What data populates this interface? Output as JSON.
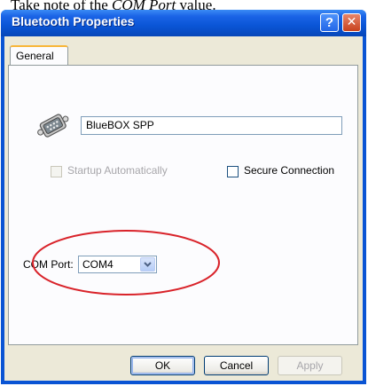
{
  "caption": {
    "prefix": "Take note of the ",
    "emphasis": "COM Port",
    "suffix": " value."
  },
  "window": {
    "title": "Bluetooth Properties",
    "help_label": "?",
    "close_label": "✕"
  },
  "tabs": [
    {
      "label": "General",
      "active": true
    }
  ],
  "device": {
    "icon": "serial-port-icon",
    "name_value": "BlueBOX SPP"
  },
  "options": {
    "startup_label": "Startup Automatically",
    "startup_checked": false,
    "startup_enabled": false,
    "secure_label": "Secure Connection",
    "secure_checked": false
  },
  "com_port": {
    "label": "COM Port:",
    "value": "COM4"
  },
  "buttons": {
    "ok": "OK",
    "cancel": "Cancel",
    "apply": "Apply"
  },
  "colors": {
    "titlebar": "#0a54d4",
    "annotation_ellipse": "#d9232a",
    "dialog_face": "#ece9d8"
  }
}
